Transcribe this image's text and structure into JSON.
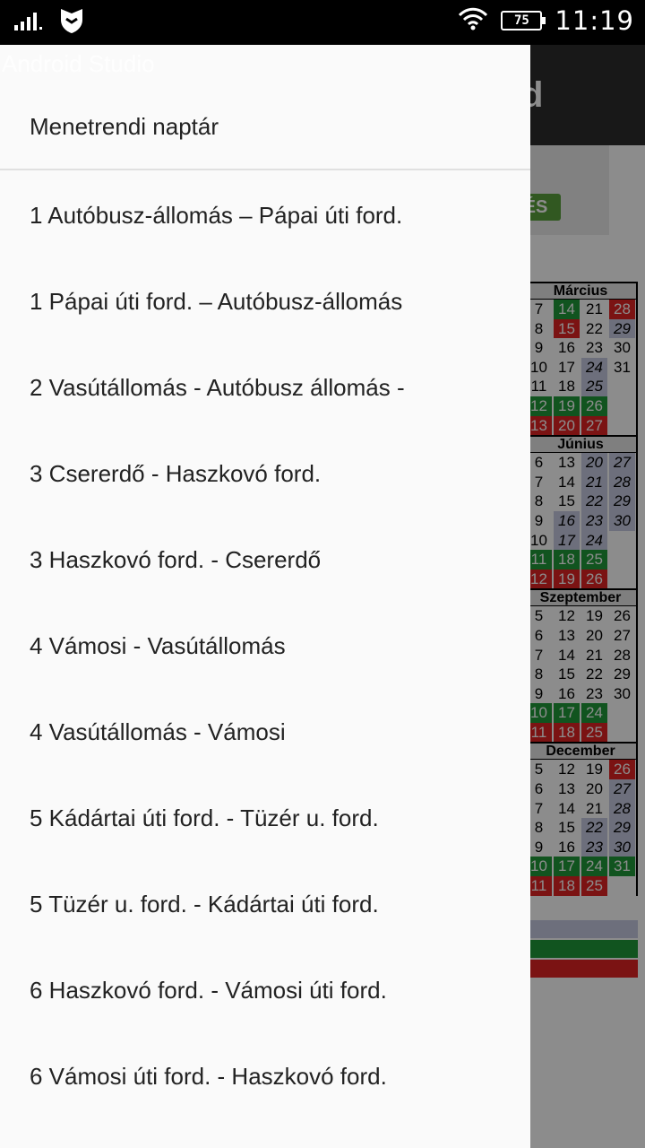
{
  "status_bar": {
    "time": "11:19",
    "battery": "75",
    "icons": [
      "signal-icon",
      "shield-icon",
      "wifi-icon",
      "battery-icon"
    ]
  },
  "background_app": {
    "title": "Android Studio",
    "header_letter": "d",
    "button_label": "ÉS",
    "calendar": [
      {
        "month": "Március",
        "weeks": [
          [
            "7",
            "14",
            "21",
            "28"
          ],
          [
            "8",
            "15",
            "22",
            "29"
          ],
          [
            "9",
            "16",
            "23",
            "30"
          ],
          [
            "10",
            "17",
            "24",
            "31"
          ],
          [
            "11",
            "18",
            "25",
            ""
          ],
          [
            "12",
            "19",
            "26",
            ""
          ],
          [
            "13",
            "20",
            "27",
            ""
          ]
        ]
      },
      {
        "month": "Június",
        "weeks": [
          [
            "6",
            "13",
            "20",
            "27"
          ],
          [
            "7",
            "14",
            "21",
            "28"
          ],
          [
            "8",
            "15",
            "22",
            "29"
          ],
          [
            "9",
            "16",
            "23",
            "30"
          ],
          [
            "10",
            "17",
            "24",
            ""
          ],
          [
            "11",
            "18",
            "25",
            ""
          ],
          [
            "12",
            "19",
            "26",
            ""
          ]
        ]
      },
      {
        "month": "Szeptember",
        "weeks": [
          [
            "5",
            "12",
            "19",
            "26"
          ],
          [
            "6",
            "13",
            "20",
            "27"
          ],
          [
            "7",
            "14",
            "21",
            "28"
          ],
          [
            "8",
            "15",
            "22",
            "29"
          ],
          [
            "9",
            "16",
            "23",
            "30"
          ],
          [
            "10",
            "17",
            "24",
            ""
          ],
          [
            "11",
            "18",
            "25",
            ""
          ]
        ]
      },
      {
        "month": "December",
        "weeks": [
          [
            "5",
            "12",
            "19",
            "26"
          ],
          [
            "6",
            "13",
            "20",
            "27"
          ],
          [
            "7",
            "14",
            "21",
            "28"
          ],
          [
            "8",
            "15",
            "22",
            "29"
          ],
          [
            "9",
            "16",
            "23",
            "30"
          ],
          [
            "10",
            "17",
            "24",
            "31"
          ],
          [
            "11",
            "18",
            "25",
            ""
          ]
        ]
      }
    ],
    "colors": {
      "red": "#e02323",
      "green": "#1f9a3a",
      "gray": "#c6cbe2"
    }
  },
  "drawer": {
    "ghost_title": "Android Studio",
    "header": "Menetrendi naptár",
    "items": [
      "1 Autóbusz-állomás – Pápai úti ford.",
      "1 Pápai úti ford. – Autóbusz-állomás",
      "2 Vasútállomás - Autóbusz állomás -",
      "3 Csererdő - Haszkovó ford.",
      "3 Haszkovó ford. - Csererdő",
      "4 Vámosi - Vasútállomás",
      "4 Vasútállomás - Vámosi",
      "5 Kádártai úti ford. - Tüzér u. ford.",
      "5 Tüzér u. ford. - Kádártai úti ford.",
      "6 Haszkovó ford. - Vámosi úti ford.",
      "6 Vámosi úti ford. - Haszkovó ford."
    ]
  }
}
